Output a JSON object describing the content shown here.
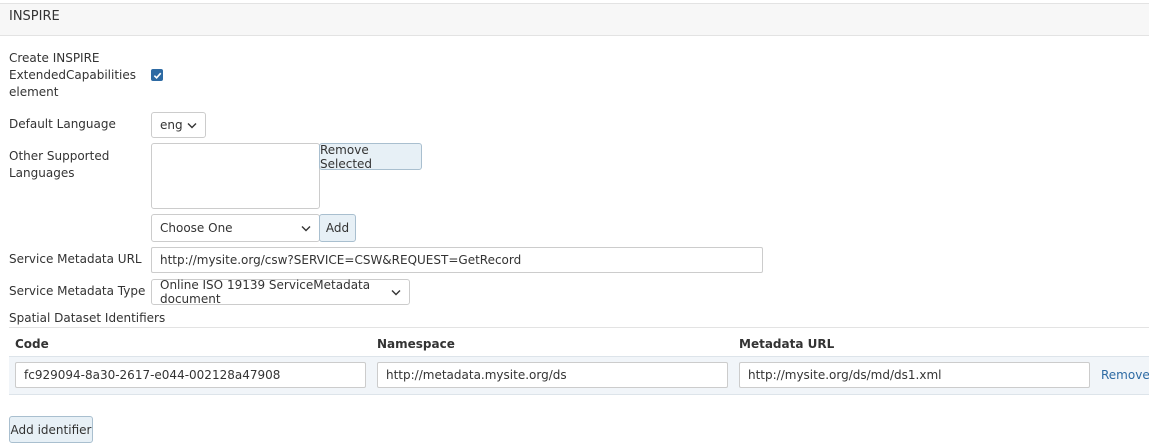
{
  "section": {
    "title": "INSPIRE"
  },
  "create_element": {
    "label": "Create INSPIRE ExtendedCapabilities element",
    "checked": true
  },
  "default_language": {
    "label": "Default Language",
    "value": "eng"
  },
  "other_languages": {
    "label": "Other Supported Languages",
    "remove_button": "Remove Selected",
    "choose_value": "Choose One",
    "add_button": "Add"
  },
  "service_metadata_url": {
    "label": "Service Metadata URL",
    "value": "http://mysite.org/csw?SERVICE=CSW&REQUEST=GetRecord"
  },
  "service_metadata_type": {
    "label": "Service Metadata Type",
    "value": "Online ISO 19139 ServiceMetadata document"
  },
  "spatial_ids": {
    "label": "Spatial Dataset Identifiers",
    "columns": [
      "Code",
      "Namespace",
      "Metadata URL"
    ],
    "rows": [
      {
        "code": "fc929094-8a30-2617-e044-002128a47908",
        "namespace": "http://metadata.mysite.org/ds",
        "metadata_url": "http://mysite.org/ds/md/ds1.xml",
        "remove": "Remove"
      }
    ],
    "add_button": "Add identifier"
  },
  "colors": {
    "accent": "#2d6aa3",
    "button_bg": "#e7f0f6",
    "row_bg": "#f1f5f9"
  }
}
